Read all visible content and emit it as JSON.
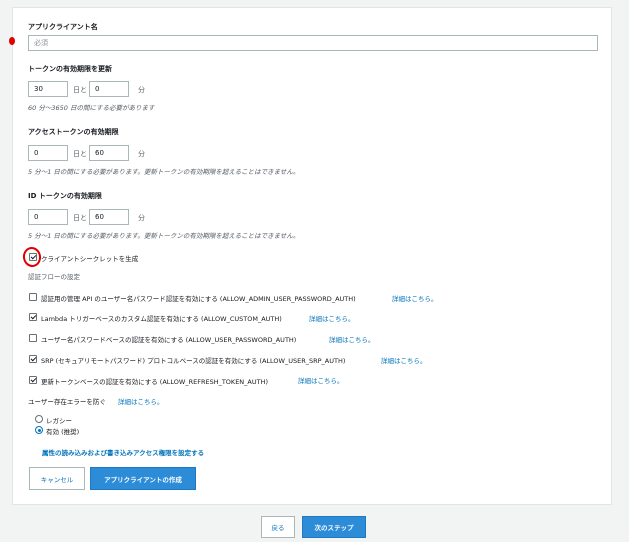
{
  "form": {
    "client_name": {
      "label": "アプリクライアント名",
      "placeholder": "必須"
    },
    "refresh_token": {
      "label": "トークンの有効期限を更新",
      "days_value": "30",
      "days_unit": "日と",
      "minutes_value": "0",
      "minutes_unit": "分",
      "hint": "60 分～3650 日の間にする必要があります"
    },
    "access_token": {
      "label": "アクセストークンの有効期限",
      "days_value": "0",
      "days_unit": "日と",
      "minutes_value": "60",
      "minutes_unit": "分",
      "hint": "5 分～1 日の間にする必要があります。更新トークンの有効期限を超えることはできません。"
    },
    "id_token": {
      "label": "ID トークンの有効期限",
      "days_value": "0",
      "days_unit": "日と",
      "minutes_value": "60",
      "minutes_unit": "分",
      "hint": "5 分～1 日の間にする必要があります。更新トークンの有効期限を超えることはできません。"
    },
    "generate_secret": {
      "label": "クライアントシークレットを生成",
      "checked": true
    },
    "auth_flows": {
      "title": "認証フローの設定",
      "link_text": "詳細はこちら。",
      "items": [
        {
          "label": "認証用の管理 API のユーザー名パスワード認証を有効にする (ALLOW_ADMIN_USER_PASSWORD_AUTH)",
          "checked": false
        },
        {
          "label": "Lambda トリガーベースのカスタム認証を有効にする (ALLOW_CUSTOM_AUTH)",
          "checked": true
        },
        {
          "label": "ユーザー名パスワードベースの認証を有効にする (ALLOW_USER_PASSWORD_AUTH)",
          "checked": false
        },
        {
          "label": "SRP (セキュアリモートパスワード) プロトコルベースの認証を有効にする (ALLOW_USER_SRP_AUTH)",
          "checked": true
        },
        {
          "label": "更新トークンベースの認証を有効にする (ALLOW_REFRESH_TOKEN_AUTH)",
          "checked": true
        }
      ]
    },
    "prevent_errors": {
      "title": "ユーザー存在エラーを防ぐ",
      "link_text": "詳細はこちら。",
      "options": [
        {
          "label": "レガシー",
          "selected": false
        },
        {
          "label": "有効 (推奨)",
          "selected": true
        }
      ]
    },
    "attr_link": "属性の読み込みおよび書き込みアクセス権限を設定する",
    "cancel_label": "キャンセル",
    "create_label": "アプリクライアントの作成"
  },
  "footer": {
    "back_label": "戻る",
    "next_label": "次のステップ"
  },
  "colors": {
    "primary": "#2d8cd8",
    "link": "#0073bb",
    "annotation": "#e00000"
  }
}
